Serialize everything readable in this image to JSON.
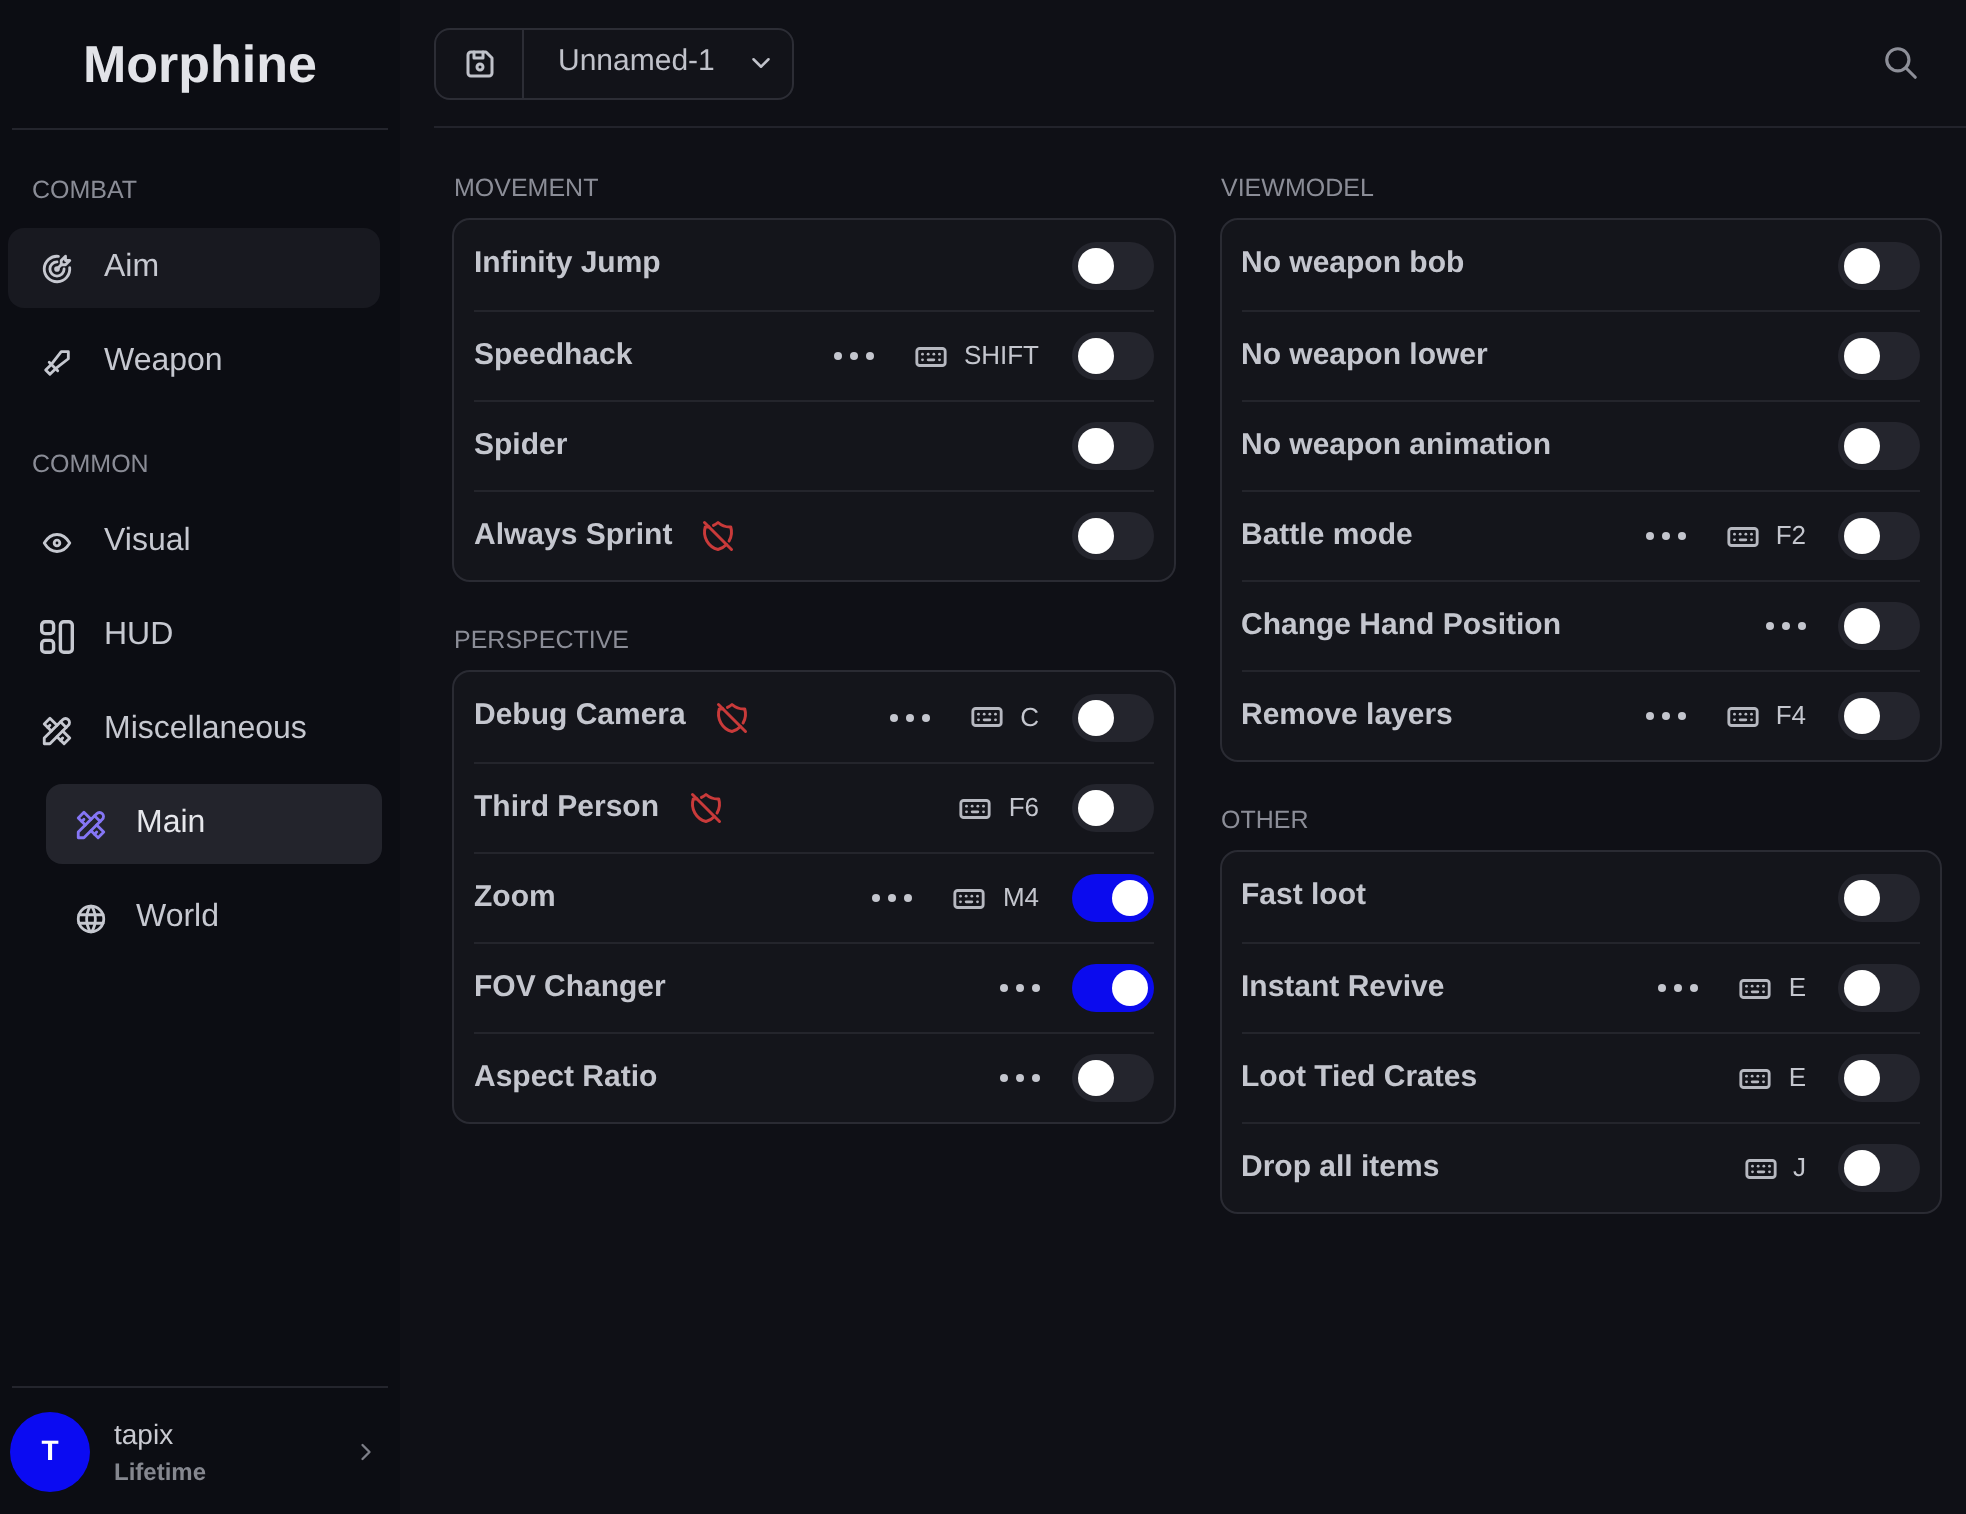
{
  "sidebar": {
    "logo": "Morphine",
    "sections": [
      {
        "title": "COMBAT",
        "items": [
          {
            "label": "Aim",
            "selected": false,
            "hovered": true
          },
          {
            "label": "Weapon",
            "selected": false,
            "hovered": false
          }
        ]
      },
      {
        "title": "COMMON",
        "items": [
          {
            "label": "Visual",
            "selected": false,
            "hovered": false
          },
          {
            "label": "HUD",
            "selected": false,
            "hovered": false
          },
          {
            "label": "Miscellaneous",
            "selected": false,
            "hovered": false,
            "children": [
              {
                "label": "Main",
                "selected": true,
                "hovered": false
              },
              {
                "label": "World",
                "selected": false,
                "hovered": false
              }
            ]
          }
        ]
      }
    ],
    "user": {
      "initial": "T",
      "name": "tapix",
      "plan": "Lifetime"
    }
  },
  "toolbar": {
    "profile": "Unnamed-1"
  },
  "columns": [
    {
      "sections": [
        {
          "title": "MOVEMENT",
          "rows": [
            {
              "label": "Infinity Jump",
              "on": false,
              "unsafe": false,
              "options": false
            },
            {
              "label": "Speedhack",
              "on": false,
              "unsafe": false,
              "options": true,
              "keybind": "SHIFT"
            },
            {
              "label": "Spider",
              "on": false,
              "unsafe": false,
              "options": false
            },
            {
              "label": "Always Sprint",
              "on": false,
              "unsafe": true,
              "options": false
            }
          ]
        },
        {
          "title": "PERSPECTIVE",
          "rows": [
            {
              "label": "Debug Camera",
              "on": false,
              "unsafe": true,
              "options": true,
              "keybind": "C"
            },
            {
              "label": "Third Person",
              "on": false,
              "unsafe": true,
              "options": false,
              "keybind": "F6"
            },
            {
              "label": "Zoom",
              "on": true,
              "unsafe": false,
              "options": true,
              "keybind": "M4"
            },
            {
              "label": "FOV Changer",
              "on": true,
              "unsafe": false,
              "options": true
            },
            {
              "label": "Aspect Ratio",
              "on": false,
              "unsafe": false,
              "options": true
            }
          ]
        }
      ]
    },
    {
      "sections": [
        {
          "title": "VIEWMODEL",
          "rows": [
            {
              "label": "No weapon bob",
              "on": false,
              "unsafe": false,
              "options": false
            },
            {
              "label": "No weapon lower",
              "on": false,
              "unsafe": false,
              "options": false
            },
            {
              "label": "No weapon animation",
              "on": false,
              "unsafe": false,
              "options": false
            },
            {
              "label": "Battle mode",
              "on": false,
              "unsafe": false,
              "options": true,
              "keybind": "F2"
            },
            {
              "label": "Change Hand Position",
              "on": false,
              "unsafe": false,
              "options": true
            },
            {
              "label": "Remove layers",
              "on": false,
              "unsafe": false,
              "options": true,
              "keybind": "F4"
            }
          ]
        },
        {
          "title": "OTHER",
          "rows": [
            {
              "label": "Fast loot",
              "on": false,
              "unsafe": false,
              "options": false
            },
            {
              "label": "Instant Revive",
              "on": false,
              "unsafe": false,
              "options": true,
              "keybind": "E"
            },
            {
              "label": "Loot Tied Crates",
              "on": false,
              "unsafe": false,
              "options": false,
              "keybind": "E"
            },
            {
              "label": "Drop all items",
              "on": false,
              "unsafe": false,
              "options": false,
              "keybind": "J"
            }
          ]
        }
      ]
    }
  ]
}
